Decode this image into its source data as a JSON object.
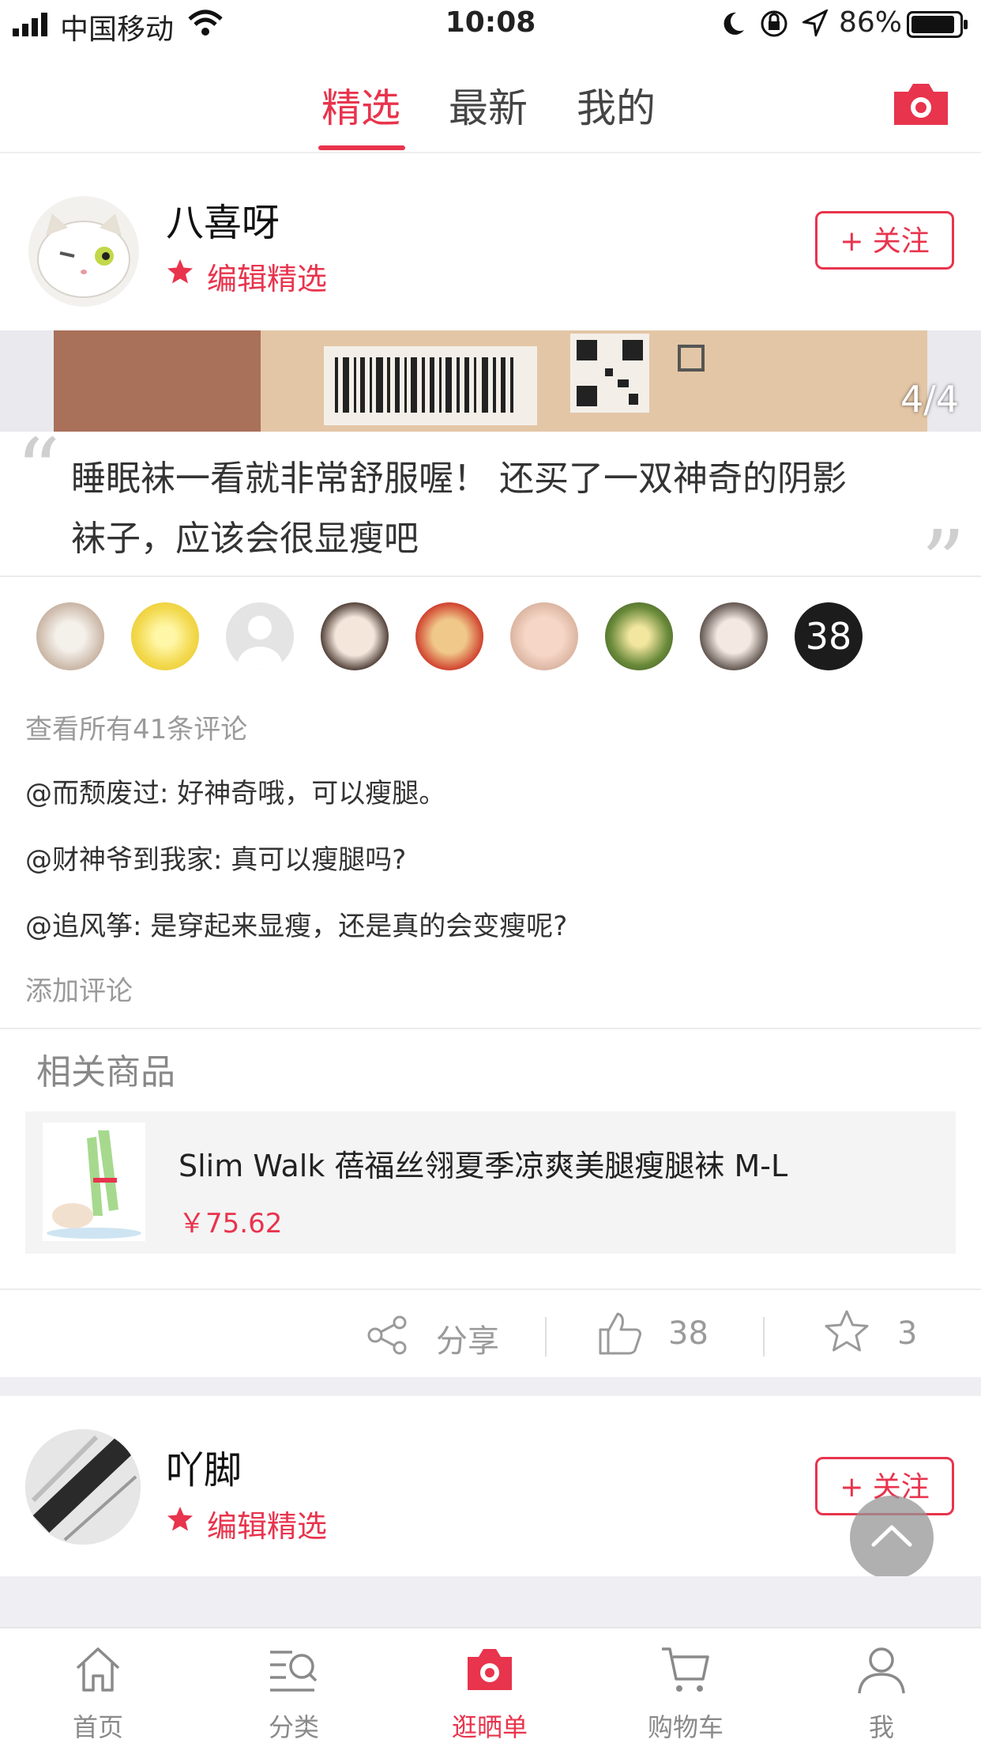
{
  "status_bar": {
    "carrier": "中国移动",
    "time": "10:08",
    "battery": "86%"
  },
  "top_tabs": [
    {
      "label": "精选",
      "active": true
    },
    {
      "label": "最新",
      "active": false
    },
    {
      "label": "我的",
      "active": false
    }
  ],
  "post1": {
    "username": "八喜呀",
    "badge": "编辑精选",
    "follow_label": "+ 关注",
    "image_counter": "4/4",
    "quote_line1": "睡眠袜一看就非常舒服喔！ 还买了一双神奇的阴影",
    "quote_line2": "袜子，应该会很显瘦吧",
    "likers_more_count": "38",
    "view_all_comments": "查看所有41条评论",
    "comments": [
      "@而颓废过: 好神奇哦，可以瘦腿。",
      "@财神爷到我家: 真可以瘦腿吗?",
      "@追风筝: 是穿起来显瘦，还是真的会变瘦呢?"
    ],
    "add_comment": "添加评论",
    "related_title": "相关商品",
    "product": {
      "name": "Slim Walk 蓓福丝翎夏季凉爽美腿瘦腿袜 M-L",
      "price": "￥75.62"
    },
    "share_label": "分享",
    "like_count": "38",
    "favorite_count": "3"
  },
  "post2": {
    "username": "吖脚",
    "badge": "编辑精选",
    "follow_label": "+ 关注"
  },
  "bottom_nav": [
    {
      "label": "首页",
      "icon": "home-icon"
    },
    {
      "label": "分类",
      "icon": "category-search-icon"
    },
    {
      "label": "逛晒单",
      "icon": "camera-icon",
      "active": true
    },
    {
      "label": "购物车",
      "icon": "cart-icon"
    },
    {
      "label": "我",
      "icon": "user-icon"
    }
  ],
  "colors": {
    "accent": "#e8344d",
    "muted": "#9a9a9a"
  }
}
